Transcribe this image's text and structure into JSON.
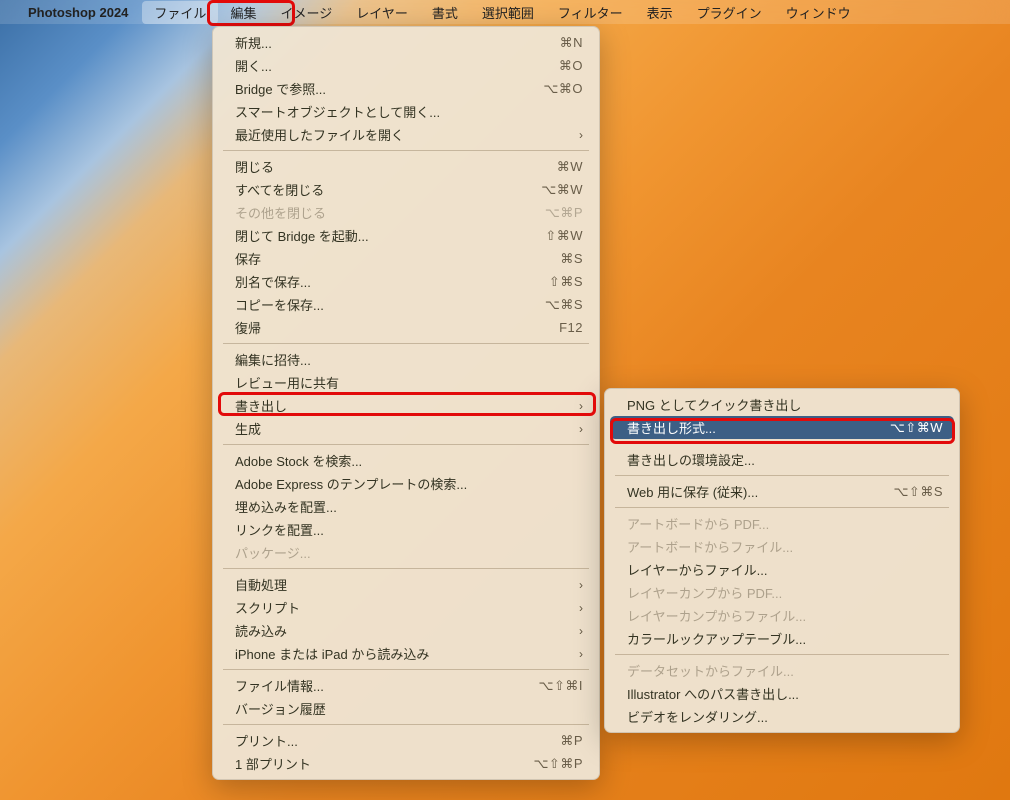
{
  "menubar": {
    "app_name": "Photoshop 2024",
    "items": [
      "ファイル",
      "編集",
      "イメージ",
      "レイヤー",
      "書式",
      "選択範囲",
      "フィルター",
      "表示",
      "プラグイン",
      "ウィンドウ"
    ]
  },
  "file_menu": [
    {
      "label": "新規...",
      "shortcut": "⌘N"
    },
    {
      "label": "開く...",
      "shortcut": "⌘O"
    },
    {
      "label": "Bridge で参照...",
      "shortcut": "⌥⌘O"
    },
    {
      "label": "スマートオブジェクトとして開く..."
    },
    {
      "label": "最近使用したファイルを開く",
      "submenu": true
    },
    {
      "sep": true
    },
    {
      "label": "閉じる",
      "shortcut": "⌘W"
    },
    {
      "label": "すべてを閉じる",
      "shortcut": "⌥⌘W"
    },
    {
      "label": "その他を閉じる",
      "shortcut": "⌥⌘P",
      "disabled": true
    },
    {
      "label": "閉じて Bridge を起動...",
      "shortcut": "⇧⌘W"
    },
    {
      "label": "保存",
      "shortcut": "⌘S"
    },
    {
      "label": "別名で保存...",
      "shortcut": "⇧⌘S"
    },
    {
      "label": "コピーを保存...",
      "shortcut": "⌥⌘S"
    },
    {
      "label": "復帰",
      "shortcut": "F12"
    },
    {
      "sep": true
    },
    {
      "label": "編集に招待..."
    },
    {
      "label": "レビュー用に共有"
    },
    {
      "label": "書き出し",
      "submenu": true,
      "annot": "export"
    },
    {
      "label": "生成",
      "submenu": true
    },
    {
      "sep": true
    },
    {
      "label": "Adobe Stock を検索..."
    },
    {
      "label": "Adobe Express のテンプレートの検索..."
    },
    {
      "label": "埋め込みを配置..."
    },
    {
      "label": "リンクを配置..."
    },
    {
      "label": "パッケージ...",
      "disabled": true
    },
    {
      "sep": true
    },
    {
      "label": "自動処理",
      "submenu": true
    },
    {
      "label": "スクリプト",
      "submenu": true
    },
    {
      "label": "読み込み",
      "submenu": true
    },
    {
      "label": "iPhone または iPad から読み込み",
      "submenu": true
    },
    {
      "sep": true
    },
    {
      "label": "ファイル情報...",
      "shortcut": "⌥⇧⌘I"
    },
    {
      "label": "バージョン履歴"
    },
    {
      "sep": true
    },
    {
      "label": "プリント...",
      "shortcut": "⌘P"
    },
    {
      "label": "1 部プリント",
      "shortcut": "⌥⇧⌘P"
    }
  ],
  "export_submenu": [
    {
      "label": "PNG としてクイック書き出し"
    },
    {
      "label": "書き出し形式...",
      "shortcut": "⌥⇧⌘W",
      "selected": true,
      "annot": "exportas"
    },
    {
      "sep": true
    },
    {
      "label": "書き出しの環境設定..."
    },
    {
      "sep": true
    },
    {
      "label": "Web 用に保存 (従来)...",
      "shortcut": "⌥⇧⌘S"
    },
    {
      "sep": true
    },
    {
      "label": "アートボードから PDF...",
      "disabled": true
    },
    {
      "label": "アートボードからファイル...",
      "disabled": true
    },
    {
      "label": "レイヤーからファイル..."
    },
    {
      "label": "レイヤーカンプから PDF...",
      "disabled": true
    },
    {
      "label": "レイヤーカンプからファイル...",
      "disabled": true
    },
    {
      "label": "カラールックアップテーブル..."
    },
    {
      "sep": true
    },
    {
      "label": "データセットからファイル...",
      "disabled": true
    },
    {
      "label": "Illustrator へのパス書き出し..."
    },
    {
      "label": "ビデオをレンダリング..."
    }
  ]
}
